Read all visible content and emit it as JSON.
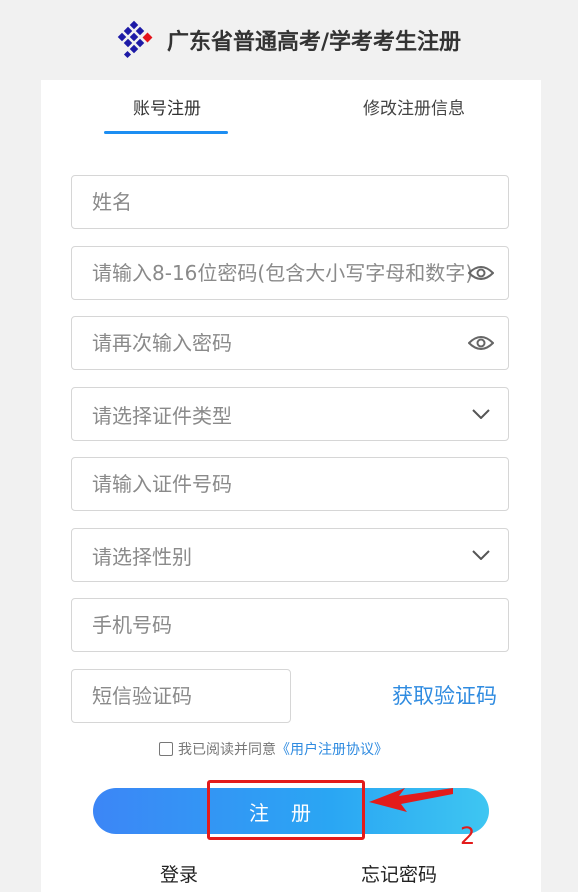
{
  "header": {
    "logo_icon": "red-blue-diamond-logo-icon",
    "title": "广东省普通高考/学考考生注册"
  },
  "tabs": [
    {
      "label": "账号注册",
      "active": true
    },
    {
      "label": "修改注册信息",
      "active": false
    }
  ],
  "form": {
    "name": {
      "placeholder": "姓名"
    },
    "password": {
      "placeholder": "请输入8-16位密码(包含大小写字母和数字)",
      "icon": "eye-icon"
    },
    "password_confirm": {
      "placeholder": "请再次输入密码",
      "icon": "eye-icon"
    },
    "id_type": {
      "placeholder": "请选择证件类型",
      "icon": "chevron-down-icon"
    },
    "id_number": {
      "placeholder": "请输入证件号码"
    },
    "gender": {
      "placeholder": "请选择性别",
      "icon": "chevron-down-icon"
    },
    "phone": {
      "placeholder": "手机号码"
    },
    "sms_code": {
      "placeholder": "短信验证码"
    },
    "get_code_label": "获取验证码"
  },
  "agreement": {
    "text": "我已阅读并同意",
    "link": "《用户注册协议》",
    "checked": false
  },
  "submit_label": "注册",
  "bottom_links": {
    "login": "登录",
    "forgot": "忘记密码"
  },
  "annotation": {
    "number": "2",
    "color": "#e31b1b"
  },
  "colors": {
    "accent": "#1d8ef2",
    "link": "#2f8be0",
    "button_gradient_start": "#3c86f6",
    "button_gradient_end": "#3ec6f2"
  }
}
